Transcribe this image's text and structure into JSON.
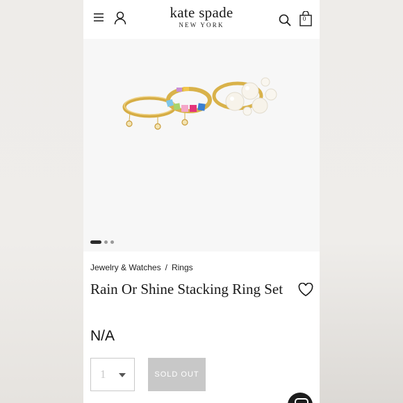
{
  "header": {
    "logo_main": "kate spade",
    "logo_sub": "NEW YORK",
    "bag_count": "0",
    "icons": [
      "menu-icon",
      "account-icon",
      "search-icon",
      "bag-icon"
    ]
  },
  "gallery": {
    "image_count": 3,
    "active_index": 0
  },
  "breadcrumb": {
    "items": [
      "Jewelry & Watches",
      "Rings"
    ],
    "separator": "/"
  },
  "product": {
    "title": "Rain Or Shine Stacking Ring Set",
    "price": "N/A",
    "wishlist_icon": "heart-outline-icon"
  },
  "purchase": {
    "quantity": "1",
    "button_label": "SOLD OUT"
  },
  "colors": {
    "text": "#1a1a1a",
    "disabled_button": "#c8c8c8",
    "ring_gold": "#d9b24a"
  }
}
